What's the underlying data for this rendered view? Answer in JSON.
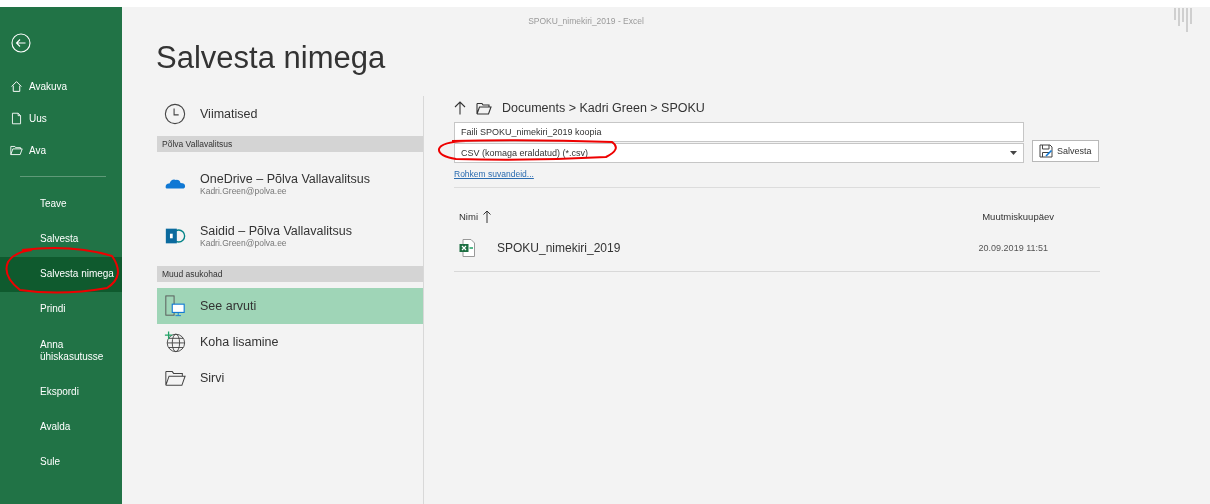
{
  "window": {
    "title": "SPOKU_nimekiri_2019  -  Excel"
  },
  "sidebar": {
    "items": [
      {
        "label": "Avakuva",
        "kind": "icon",
        "selected": false
      },
      {
        "label": "Uus",
        "kind": "icon",
        "selected": false
      },
      {
        "label": "Ava",
        "kind": "icon",
        "selected": false
      },
      {
        "label": "Teave",
        "kind": "text",
        "selected": false
      },
      {
        "label": "Salvesta",
        "kind": "text",
        "selected": false
      },
      {
        "label": "Salvesta nimega",
        "kind": "text",
        "selected": true
      },
      {
        "label": "Prindi",
        "kind": "text",
        "selected": false
      },
      {
        "label": "Anna ühiskasutusse",
        "kind": "text",
        "selected": false
      },
      {
        "label": "Ekspordi",
        "kind": "text",
        "selected": false
      },
      {
        "label": "Avalda",
        "kind": "text",
        "selected": false
      },
      {
        "label": "Sule",
        "kind": "text",
        "selected": false
      }
    ]
  },
  "page_title": "Salvesta nimega",
  "locations": [
    {
      "kind": "place",
      "label": "Viimatised",
      "selected": false
    },
    {
      "kind": "header",
      "label": "Põlva Vallavalitsus"
    },
    {
      "kind": "account",
      "label": "OneDrive – Põlva Vallavalitsus",
      "sub": "Kadri.Green@polva.ee",
      "selected": false
    },
    {
      "kind": "account",
      "label": "Saidid – Põlva Vallavalitsus",
      "sub": "Kadri.Green@polva.ee",
      "selected": false
    },
    {
      "kind": "header",
      "label": "Muud asukohad"
    },
    {
      "kind": "place",
      "label": "See arvuti",
      "selected": true
    },
    {
      "kind": "place",
      "label": "Koha lisamine",
      "selected": false
    },
    {
      "kind": "place",
      "label": "Sirvi",
      "selected": false
    }
  ],
  "breadcrumb": "Documents > Kadri Green > SPOKU",
  "file_name": "Faili SPOKU_nimekiri_2019 koopia",
  "file_type": "CSV (komaga eraldatud) (*.csv)",
  "save_button": "Salvesta",
  "more_options": "Rohkem suvandeid...",
  "files": {
    "columns": [
      "Nimi",
      "Muutmiskuupäev"
    ],
    "rows": [
      {
        "name": "SPOKU_nimekiri_2019",
        "modified": "20.09.2019 11:51"
      }
    ]
  }
}
